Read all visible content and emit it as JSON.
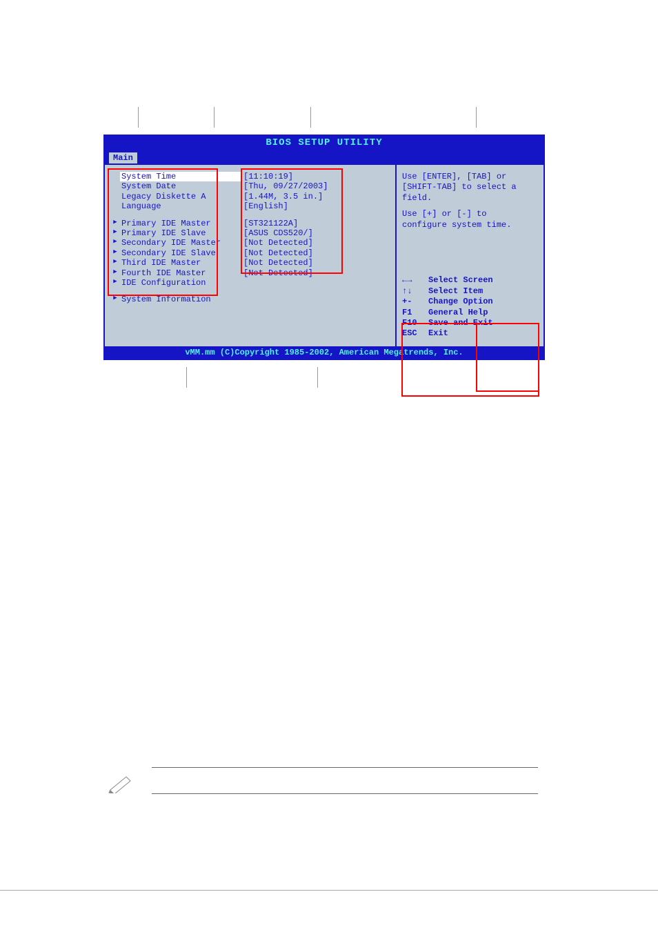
{
  "title": "BIOS SETUP UTILITY",
  "tab": "Main",
  "menu": {
    "system_time": {
      "label": "System Time",
      "value": "[11:10:19]"
    },
    "system_date": {
      "label": "System Date",
      "value": "[Thu, 09/27/2003]"
    },
    "legacy_diskette": {
      "label": "Legacy Diskette A",
      "value": "[1.44M, 3.5 in.]"
    },
    "language": {
      "label": "Language",
      "value": "[English]"
    },
    "primary_ide_master": {
      "label": "Primary IDE Master",
      "value": "[ST321122A]"
    },
    "primary_ide_slave": {
      "label": "Primary IDE Slave",
      "value": "[ASUS CDS520/]"
    },
    "secondary_ide_master": {
      "label": "Secondary IDE Master",
      "value": "[Not Detected]"
    },
    "secondary_ide_slave": {
      "label": "Secondary IDE Slave",
      "value": "[Not Detected]"
    },
    "third_ide_master": {
      "label": "Third IDE Master",
      "value": "[Not Detected]"
    },
    "fourth_ide_master": {
      "label": "Fourth IDE Master",
      "value": "[Not Detected]"
    },
    "ide_configuration": {
      "label": "IDE Configuration",
      "value": ""
    },
    "system_information": {
      "label": "System Information",
      "value": ""
    }
  },
  "help": {
    "line1": "Use [ENTER], [TAB] or",
    "line2": "[SHIFT-TAB] to select a",
    "line3": "field.",
    "line4": "Use [+] or [-] to",
    "line5": "configure system time."
  },
  "nav": {
    "select_screen_key": "←→",
    "select_screen_label": "Select Screen",
    "select_item_key": "↑↓",
    "select_item_label": "Select Item",
    "change_option_key": "+-",
    "change_option_label": "Change Option",
    "general_help_key": "F1",
    "general_help_label": "General Help",
    "save_exit_key": "F10",
    "save_exit_label": "Save and Exit",
    "exit_key": "ESC",
    "exit_label": "Exit"
  },
  "status": "vMM.mm (C)Copyright 1985-2002, American Megatrends, Inc."
}
